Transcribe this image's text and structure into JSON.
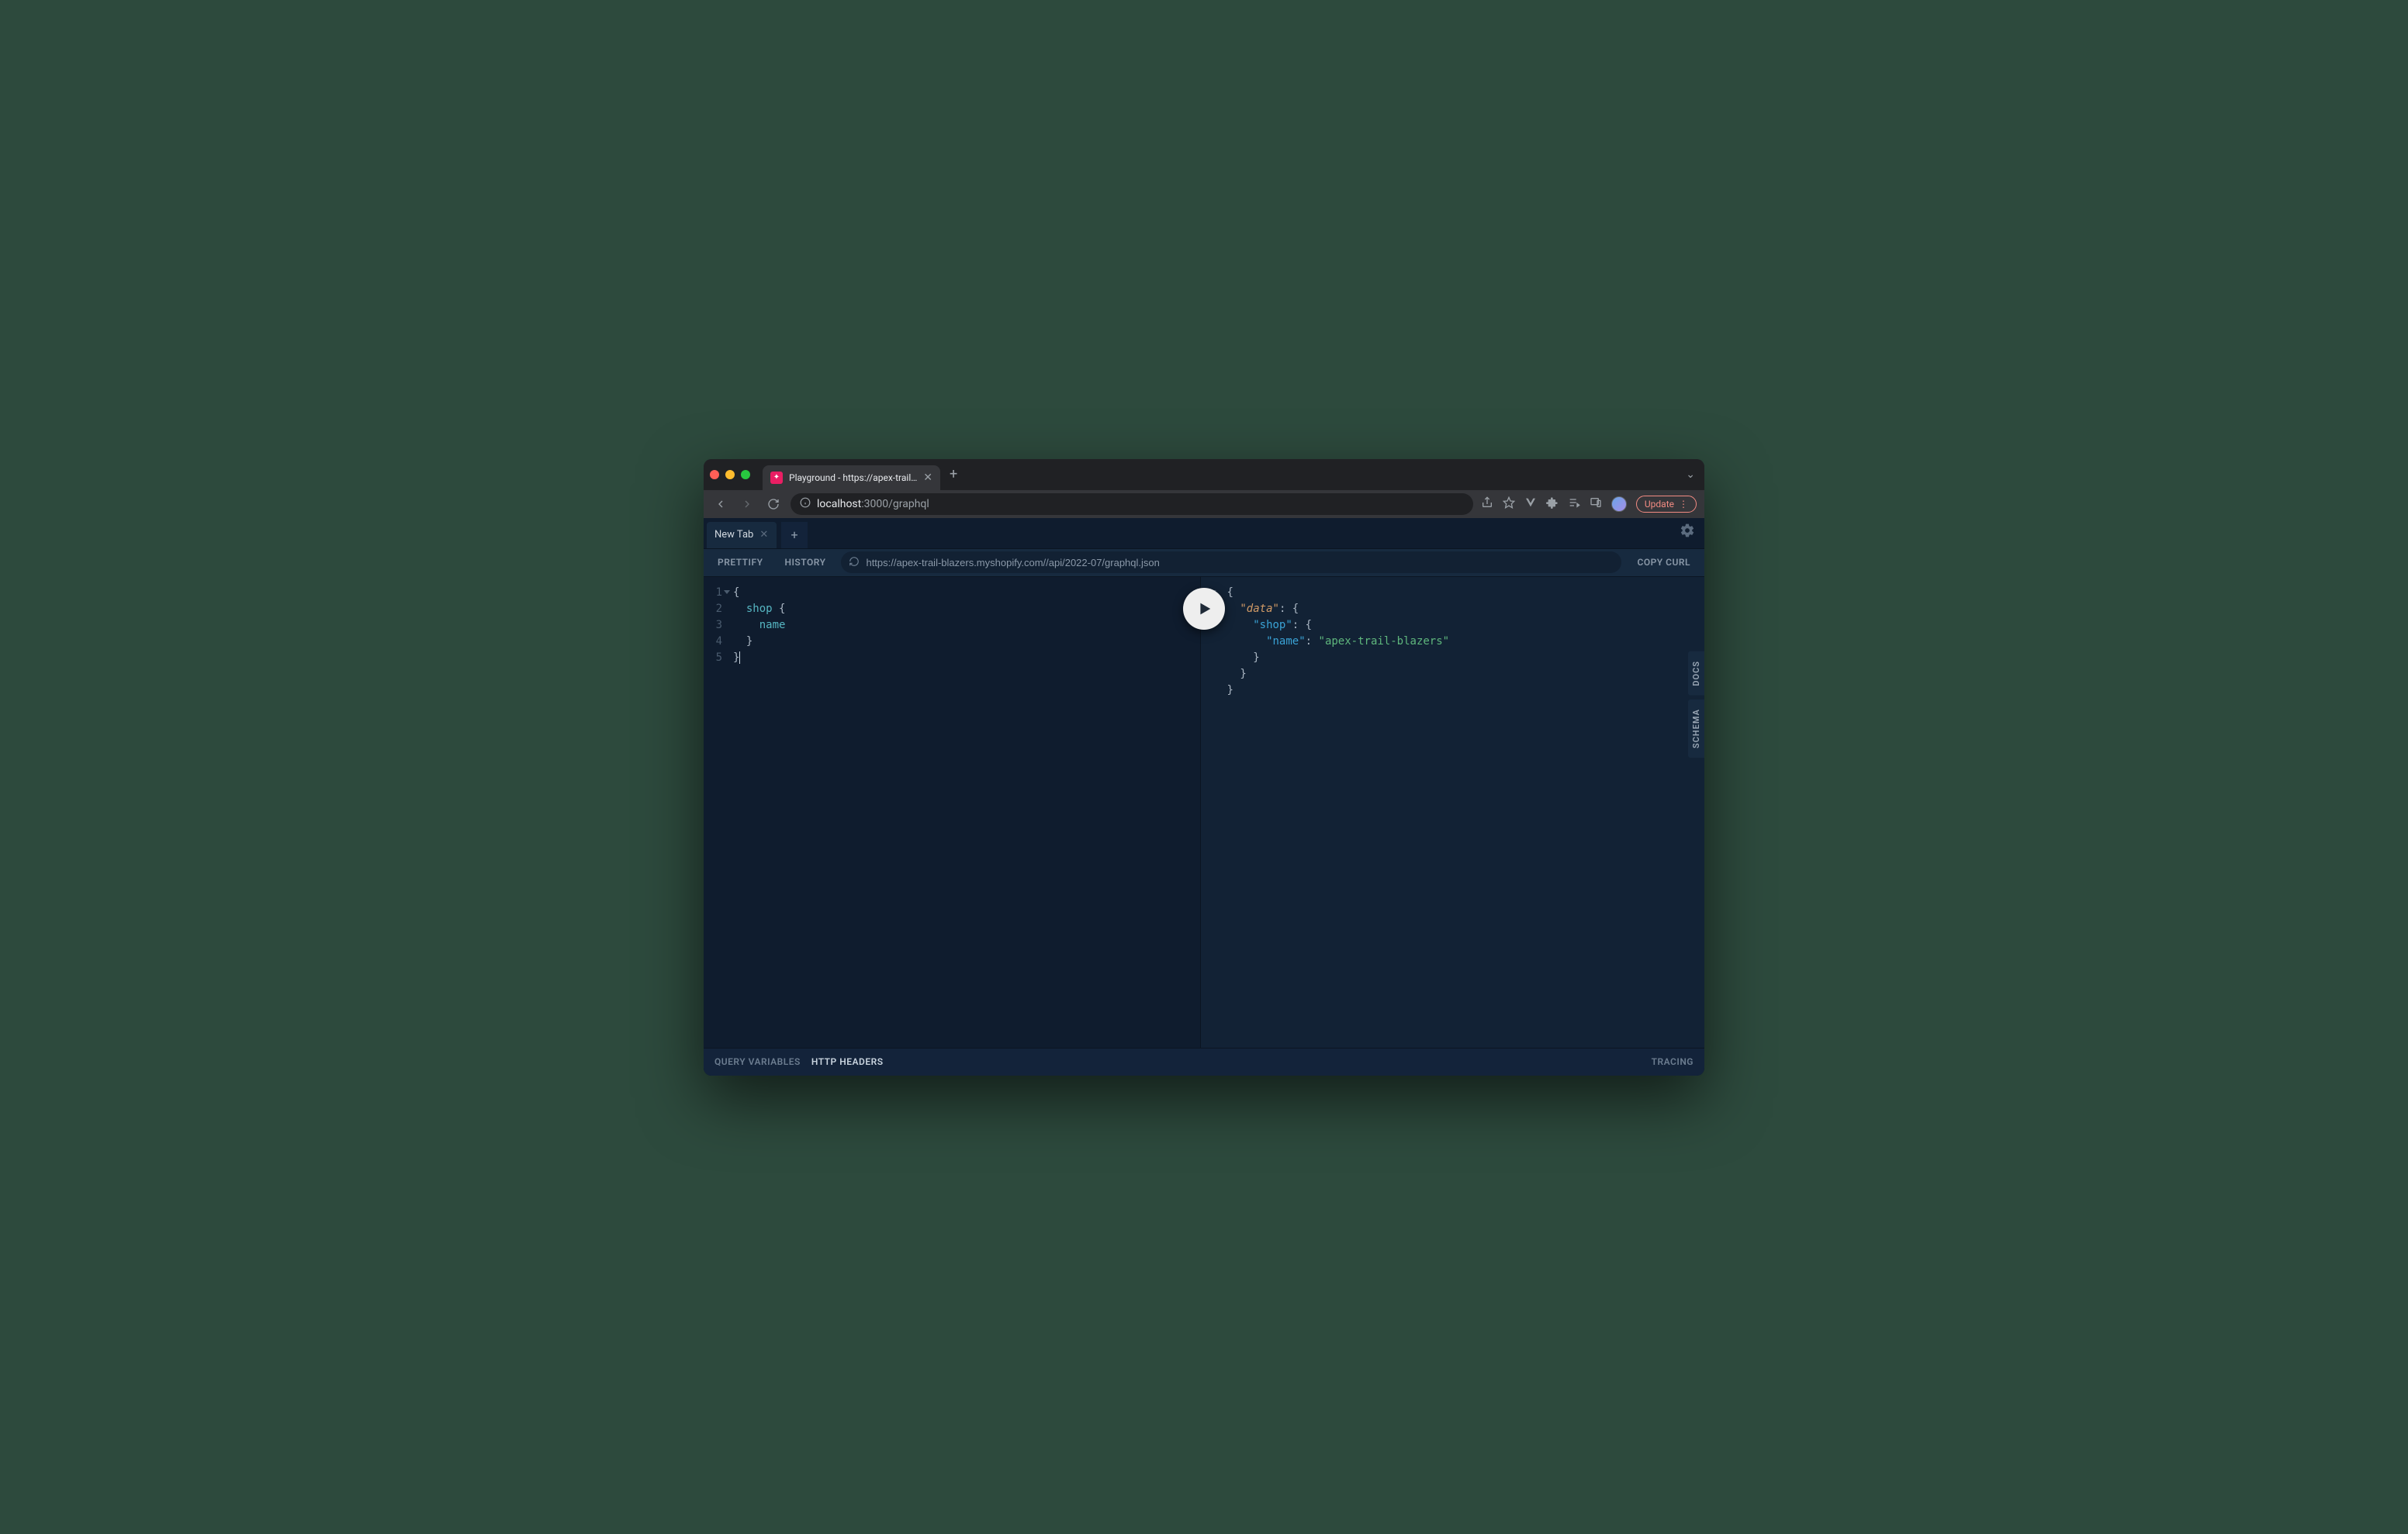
{
  "browser": {
    "tab_title": "Playground - https://apex-trail…",
    "url_host": "localhost",
    "url_port": ":3000",
    "url_path": "/graphql",
    "update_label": "Update"
  },
  "playground": {
    "tab_label": "New Tab",
    "toolbar": {
      "prettify": "PRETTIFY",
      "history": "HISTORY",
      "copy_curl": "COPY CURL",
      "endpoint": "https://apex-trail-blazers.myshopify.com//api/2022-07/graphql.json"
    },
    "side": {
      "docs": "DOCS",
      "schema": "SCHEMA"
    },
    "bottom": {
      "query_variables": "QUERY VARIABLES",
      "http_headers": "HTTP HEADERS",
      "tracing": "TRACING"
    },
    "query": {
      "lines": [
        "1",
        "2",
        "3",
        "4",
        "5"
      ],
      "l1": "{",
      "l2a": "shop",
      "l2b": " {",
      "l3": "name",
      "l4": "}",
      "l5": "}"
    },
    "result": {
      "data_key": "\"data\"",
      "shop_key": "\"shop\"",
      "name_key": "\"name\"",
      "name_val": "\"apex-trail-blazers\""
    }
  }
}
